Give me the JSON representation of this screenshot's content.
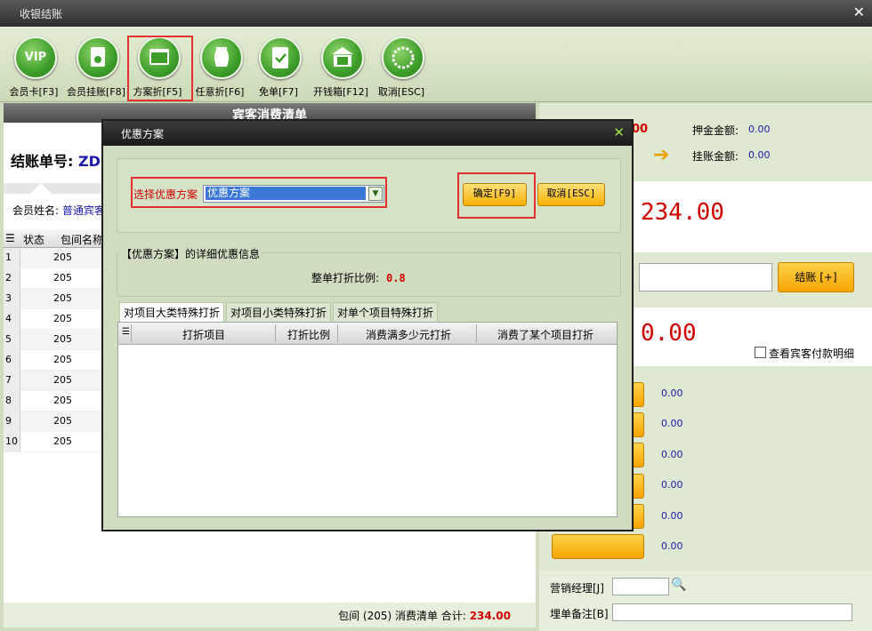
{
  "window": {
    "title": "收银结账",
    "close": "✕"
  },
  "toolbar": {
    "items": [
      {
        "label": "会员卡[F3]",
        "icon_text": "VIP"
      },
      {
        "label": "会员挂账[F8]",
        "icon_text": ""
      },
      {
        "label": "方案折[F5]",
        "icon_text": ""
      },
      {
        "label": "任意折[F6]",
        "icon_text": ""
      },
      {
        "label": "免单[F7]",
        "icon_text": ""
      },
      {
        "label": "开钱箱[F12]",
        "icon_text": ""
      },
      {
        "label": "取消[ESC]",
        "icon_text": ""
      }
    ]
  },
  "left": {
    "header": "宾客消费清单",
    "bill_label": "结账单号:",
    "bill_value": "ZD",
    "member_label": "会员姓名:",
    "member_value": "普通宾客",
    "columns": [
      "状态",
      "包间名称"
    ],
    "rows": [
      {
        "n": "1",
        "room": "205"
      },
      {
        "n": "2",
        "room": "205"
      },
      {
        "n": "3",
        "room": "205"
      },
      {
        "n": "4",
        "room": "205"
      },
      {
        "n": "5",
        "room": "205"
      },
      {
        "n": "6",
        "room": "205"
      },
      {
        "n": "7",
        "room": "205"
      },
      {
        "n": "8",
        "room": "205"
      },
      {
        "n": "9",
        "room": "205"
      },
      {
        "n": "10",
        "room": "205"
      }
    ],
    "footer_text": "包间 (205) 消费清单 合计:",
    "footer_total": "234.00"
  },
  "right": {
    "partial_value": "00",
    "deposit_label": "押金金额:",
    "deposit_value": "0.00",
    "credit_label": "挂账金额:",
    "credit_value": "0.00",
    "total_big": "234.00",
    "checkout_button": "结账 [+]",
    "change_big": "0.00",
    "guest_payment_detail": "查看宾客付款明细",
    "payment_values": [
      "0.00",
      "0.00",
      "0.00",
      "0.00",
      "0.00",
      "0.00"
    ],
    "sales_manager_label": "营销经理[J]",
    "remark_label": "埋单备注[B]"
  },
  "modal": {
    "title": "优惠方案",
    "select_label": "选择优惠方案",
    "select_value": "优惠方案",
    "ok_button": "确定[F9]",
    "cancel_button": "取消[ESC]",
    "detail_title": "【优惠方案】的详细优惠信息",
    "ratio_label": "整单打折比例:",
    "ratio_value": "0.8",
    "tabs": [
      "对项目大类特殊打折",
      "对项目小类特殊打折",
      "对单个项目特殊打折"
    ],
    "grid_columns": [
      "打折项目",
      "打折比例",
      "消费满多少元打折",
      "消费了某个项目打折"
    ]
  }
}
